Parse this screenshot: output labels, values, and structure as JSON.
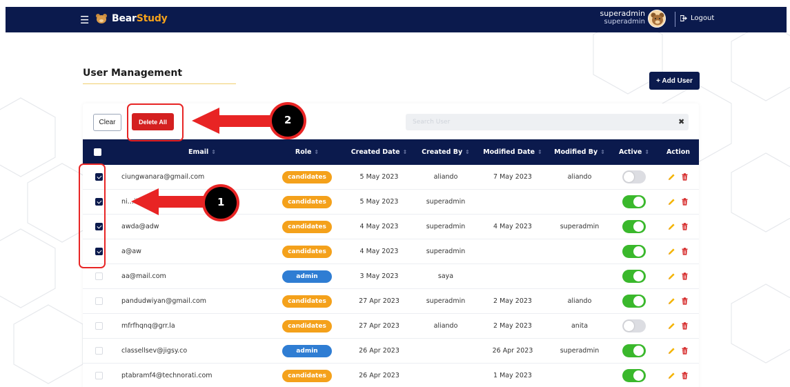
{
  "app": {
    "brand_part1": "Bear",
    "brand_part2": "Study",
    "user_name": "superadmin",
    "user_role": "superadmin",
    "logout_label": "Logout"
  },
  "page": {
    "title": "User Management",
    "add_user_label": "+ Add User",
    "clear_label": "Clear",
    "delete_all_label": "Delete All",
    "search_placeholder": "Search User"
  },
  "table": {
    "columns": [
      "Email",
      "Role",
      "Created Date",
      "Created By",
      "Modified Date",
      "Modified By",
      "Active",
      "Action"
    ],
    "rows": [
      {
        "checked": true,
        "email": "ciungwanara@gmail.com",
        "role": "candidates",
        "created_date": "5 May 2023",
        "created_by": "aliando",
        "modified_date": "7 May 2023",
        "modified_by": "aliando",
        "active": false
      },
      {
        "checked": true,
        "email": "ni…il.co",
        "role": "candidates",
        "created_date": "5 May 2023",
        "created_by": "superadmin",
        "modified_date": "",
        "modified_by": "",
        "active": true
      },
      {
        "checked": true,
        "email": "awda@adw",
        "role": "candidates",
        "created_date": "4 May 2023",
        "created_by": "superadmin",
        "modified_date": "4 May 2023",
        "modified_by": "superadmin",
        "active": true
      },
      {
        "checked": true,
        "email": "a@aw",
        "role": "candidates",
        "created_date": "4 May 2023",
        "created_by": "superadmin",
        "modified_date": "",
        "modified_by": "",
        "active": true
      },
      {
        "checked": false,
        "email": "aa@mail.com",
        "role": "admin",
        "created_date": "3 May 2023",
        "created_by": "saya",
        "modified_date": "",
        "modified_by": "",
        "active": true
      },
      {
        "checked": false,
        "email": "pandudwiyan@gmail.com",
        "role": "candidates",
        "created_date": "27 Apr 2023",
        "created_by": "superadmin",
        "modified_date": "2 May 2023",
        "modified_by": "aliando",
        "active": true
      },
      {
        "checked": false,
        "email": "mfrfhqnq@grr.la",
        "role": "candidates",
        "created_date": "27 Apr 2023",
        "created_by": "aliando",
        "modified_date": "2 May 2023",
        "modified_by": "anita",
        "active": false
      },
      {
        "checked": false,
        "email": "classellsev@jigsy.co",
        "role": "admin",
        "created_date": "26 Apr 2023",
        "created_by": "",
        "modified_date": "26 Apr 2023",
        "modified_by": "superadmin",
        "active": true
      },
      {
        "checked": false,
        "email": "ptabramf4@technorati.com",
        "role": "candidates",
        "created_date": "26 Apr 2023",
        "created_by": "",
        "modified_date": "1 May 2023",
        "modified_by": "",
        "active": true
      }
    ]
  },
  "annotations": {
    "step1": "1",
    "step2": "2"
  },
  "colors": {
    "navy": "#0b1a4d",
    "candidates_badge": "#f4a11b",
    "admin_badge": "#2f7dd3",
    "danger": "#d42020",
    "active_on": "#3ab82c",
    "annotation_red": "#e82424"
  }
}
